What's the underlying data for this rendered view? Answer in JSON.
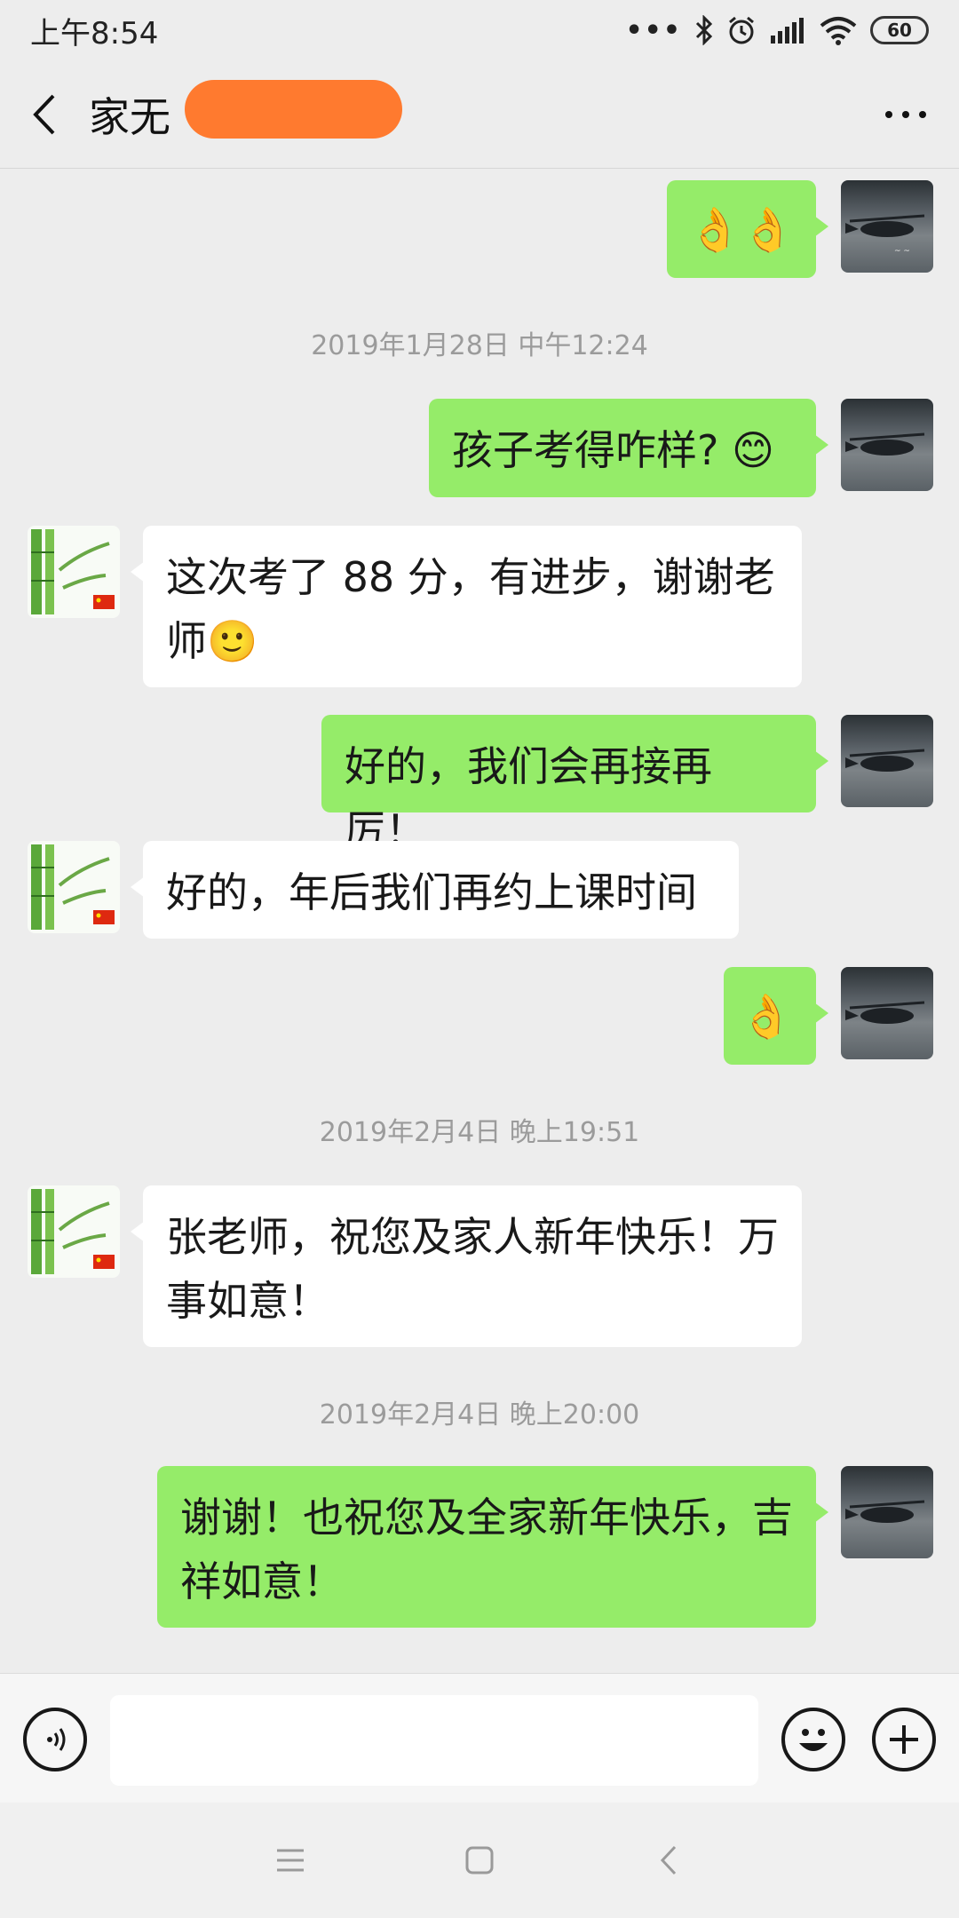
{
  "status_bar": {
    "time": "上午8:54",
    "dots": "•••",
    "battery": "60"
  },
  "header": {
    "title": "家无",
    "redacted": true
  },
  "messages": [
    {
      "sender": "me",
      "text": "👌👌"
    },
    {
      "type": "timestamp",
      "text": "2019年1月28日 中午12:24"
    },
    {
      "sender": "me",
      "text": "孩子考得咋样? 😊"
    },
    {
      "sender": "them",
      "line1": "这次考了 88 分，有进步，谢谢老",
      "line2": "师🙂"
    },
    {
      "sender": "me",
      "text": "好的，我们会再接再厉！"
    },
    {
      "sender": "them",
      "text": "好的，年后我们再约上课时间"
    },
    {
      "sender": "me",
      "text": "👌"
    },
    {
      "type": "timestamp",
      "text": "2019年2月4日 晚上19:51"
    },
    {
      "sender": "them",
      "line1": "张老师，祝您及家人新年快乐！万",
      "line2": "事如意！"
    },
    {
      "type": "timestamp",
      "text": "2019年2月4日 晚上20:00"
    },
    {
      "sender": "me",
      "line1": "谢谢！也祝您及全家新年快乐，吉",
      "line2": "祥如意！"
    }
  ],
  "input_bar": {
    "placeholder": ""
  },
  "colors": {
    "self_bubble": "#95ec69",
    "other_bubble": "#ffffff",
    "background": "#ededed",
    "redaction": "#ff7a2f"
  },
  "icons": {
    "back": "chevron-left-icon",
    "more": "more-dots-icon",
    "voice": "voice-icon",
    "emoji": "emoji-icon",
    "plus": "plus-icon",
    "nav_menu": "menu-icon",
    "nav_home": "home-icon",
    "nav_back": "back-icon"
  }
}
